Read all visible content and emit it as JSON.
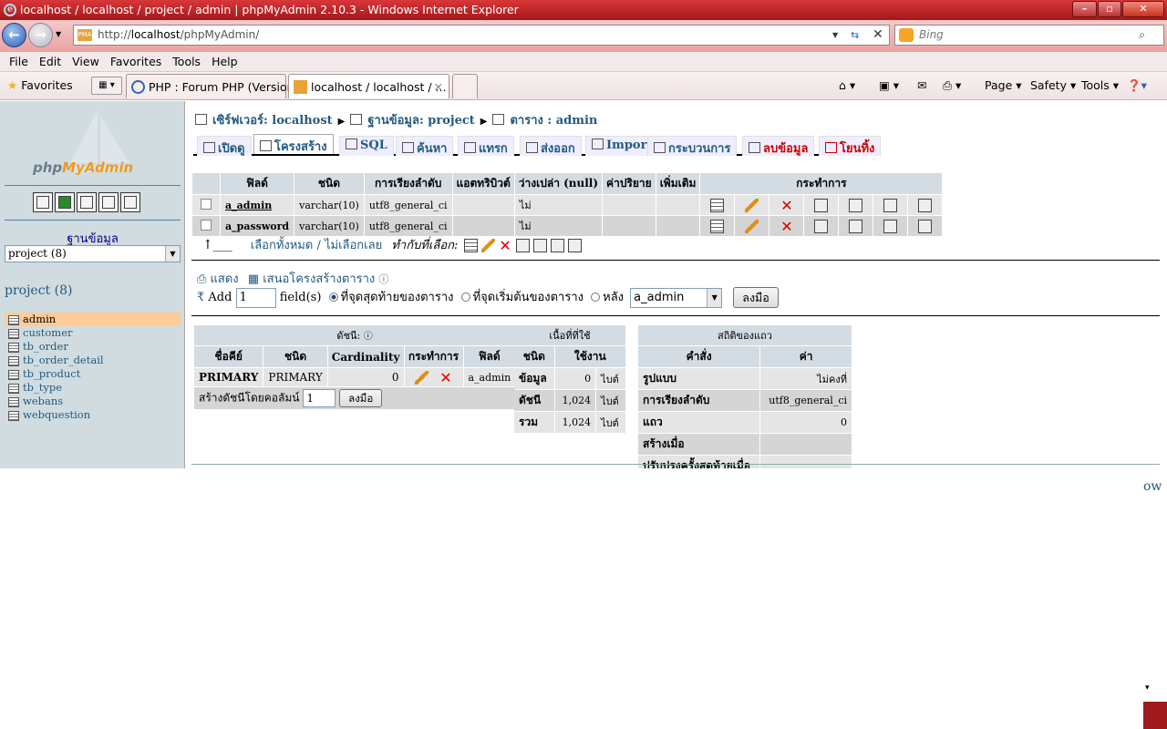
{
  "window": {
    "title": "localhost / localhost / project / admin | phpMyAdmin 2.10.3 - Windows Internet Explorer"
  },
  "address": {
    "url_prefix": "http://",
    "url_host": "localhost",
    "url_path": "/phpMyAdmin/",
    "search_placeholder": "Bing"
  },
  "menu": [
    "File",
    "Edit",
    "View",
    "Favorites",
    "Tools",
    "Help"
  ],
  "favorites": {
    "label": "Favorites",
    "tabs": [
      {
        "label": "PHP : Forum PHP (Version..."
      },
      {
        "label": "localhost / localhost / ..."
      }
    ],
    "commands": [
      "Page",
      "Safety",
      "Tools"
    ]
  },
  "sidebar": {
    "logo_php": "php",
    "logo_my": "MyAdmin",
    "db_label": "ฐานข้อมูล",
    "db_select": "project (8)",
    "db_title": "project (8)",
    "tables": [
      "admin",
      "customer",
      "tb_order",
      "tb_order_detail",
      "tb_product",
      "tb_type",
      "webans",
      "webquestion"
    ]
  },
  "breadcrumb": {
    "server": "เซิร์ฟเวอร์: localhost",
    "database": "ฐานข้อมูล: project",
    "table": "ตาราง : admin"
  },
  "tabs": [
    "เปิดดู",
    "โครงสร้าง",
    "SQL",
    "ค้นหา",
    "แทรก",
    "ส่งออก",
    "Import",
    "กระบวนการ",
    "ลบข้อมูล",
    "โยนทิ้ง"
  ],
  "fields": {
    "headers": [
      "ฟิลด์",
      "ชนิด",
      "การเรียงลำดับ",
      "แอตทริบิวต์",
      "ว่างเปล่า (null)",
      "ค่าปริยาย",
      "เพิ่มเติม",
      "กระทำการ"
    ],
    "rows": [
      {
        "name": "a_admin",
        "type": "varchar(10)",
        "collation": "utf8_general_ci",
        "attr": "",
        "null": "ไม่",
        "default": "",
        "extra": ""
      },
      {
        "name": "a_password",
        "type": "varchar(10)",
        "collation": "utf8_general_ci",
        "attr": "",
        "null": "ไม่",
        "default": "",
        "extra": ""
      }
    ]
  },
  "with_selected": {
    "check_all": "เลือกทั้งหมด",
    "separator": " / ",
    "uncheck_all": "ไม่เลือกเลย",
    "label": "ทำกับที่เลือก:"
  },
  "print_row": {
    "print": "แสดง",
    "propose": "เสนอโครงสร้างตาราง"
  },
  "add_row": {
    "add": "Add",
    "count": "1",
    "fields": "field(s)",
    "at_end": "ที่จุดสุดท้ายของตาราง",
    "at_begin": "ที่จุดเริ่มต้นของตาราง",
    "after": "หลัง",
    "after_field": "a_admin",
    "go": "ลงมือ"
  },
  "indexes": {
    "caption": "ดัชนี:",
    "headers": [
      "ชื่อคีย์",
      "ชนิด",
      "Cardinality",
      "กระทำการ",
      "ฟิลด์"
    ],
    "row": {
      "key": "PRIMARY",
      "type": "PRIMARY",
      "card": "0",
      "field": "a_admin"
    },
    "create_label": "สร้างดัชนีโดยคอลัมน์",
    "create_count": "1",
    "go": "ลงมือ"
  },
  "space": {
    "caption": "เนื้อที่ที่ใช้",
    "headers": [
      "ชนิด",
      "ใช้งาน"
    ],
    "rows": [
      {
        "type": "ข้อมูล",
        "value": "0",
        "unit": "ไบต์"
      },
      {
        "type": "ดัชนี",
        "value": "1,024",
        "unit": "ไบต์"
      },
      {
        "type": "รวม",
        "value": "1,024",
        "unit": "ไบต์"
      }
    ]
  },
  "rowstats": {
    "caption": "สถิติของแถว",
    "headers": [
      "คำสั่ง",
      "ค่า"
    ],
    "rows": [
      {
        "label": "รูปแบบ",
        "value": "ไม่คงที่"
      },
      {
        "label": "การเรียงลำดับ",
        "value": "utf8_general_ci"
      },
      {
        "label": "แถว",
        "value": "0"
      },
      {
        "label": "สร้างเมื่อ",
        "value": ""
      },
      {
        "label": "ปรับปรุงครั้งสุดท้ายเมื่อ",
        "value": ""
      }
    ]
  },
  "edge_text": "ow"
}
